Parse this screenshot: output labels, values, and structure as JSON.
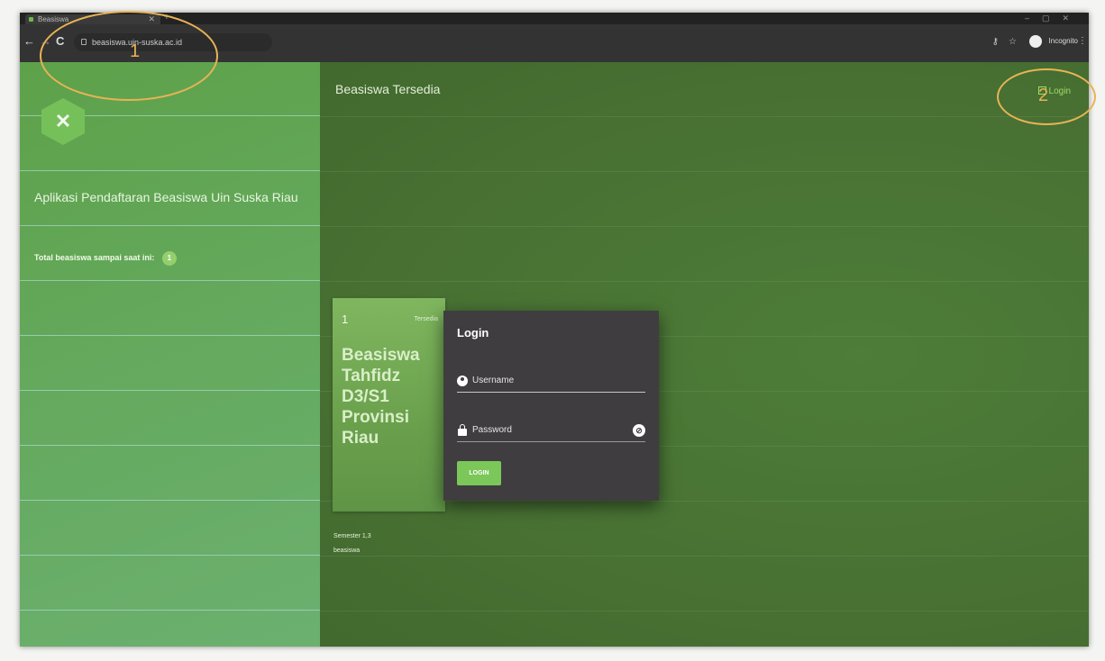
{
  "browser": {
    "tab_title": "Beasiswa",
    "new_tab_symbol": "+",
    "url": "beasiswa.uin-suska.ac.id",
    "incognito_label": "Incognito",
    "nav": {
      "back": "←",
      "forward": "→",
      "reload": "C"
    }
  },
  "sidebar": {
    "app_title": "Aplikasi Pendaftaran Beasiswa Uin Suska Riau",
    "total_label": "Total beasiswa sampai saat ini:",
    "total_count": "1"
  },
  "main": {
    "title": "Beasiswa Tersedia",
    "login_link": "Login"
  },
  "scholarship_card": {
    "number": "1",
    "status": "Tersedia",
    "title": "Beasiswa Tahfidz D3/S1 Provinsi Riau",
    "semester": "Semester 1,3",
    "note_line1": "",
    "note_line2": "beasiswa"
  },
  "login_modal": {
    "title": "Login",
    "username_placeholder": "Username",
    "password_placeholder": "Password",
    "submit_label": "LOGIN"
  },
  "annotations": {
    "marker_1": "1",
    "marker_2": "2",
    "color": "#e9b355"
  },
  "colors": {
    "sidebar_green": "#63a85a",
    "main_green": "#4b7a34",
    "button_green": "#7cc75a",
    "modal_bg": "#403d40"
  },
  "icons": [
    "back-arrow-icon",
    "forward-arrow-icon",
    "reload-icon",
    "lock-icon",
    "key-icon",
    "star-icon",
    "incognito-icon",
    "menu-dots-icon",
    "user-icon",
    "password-lock-icon",
    "eye-off-icon",
    "login-icon"
  ]
}
